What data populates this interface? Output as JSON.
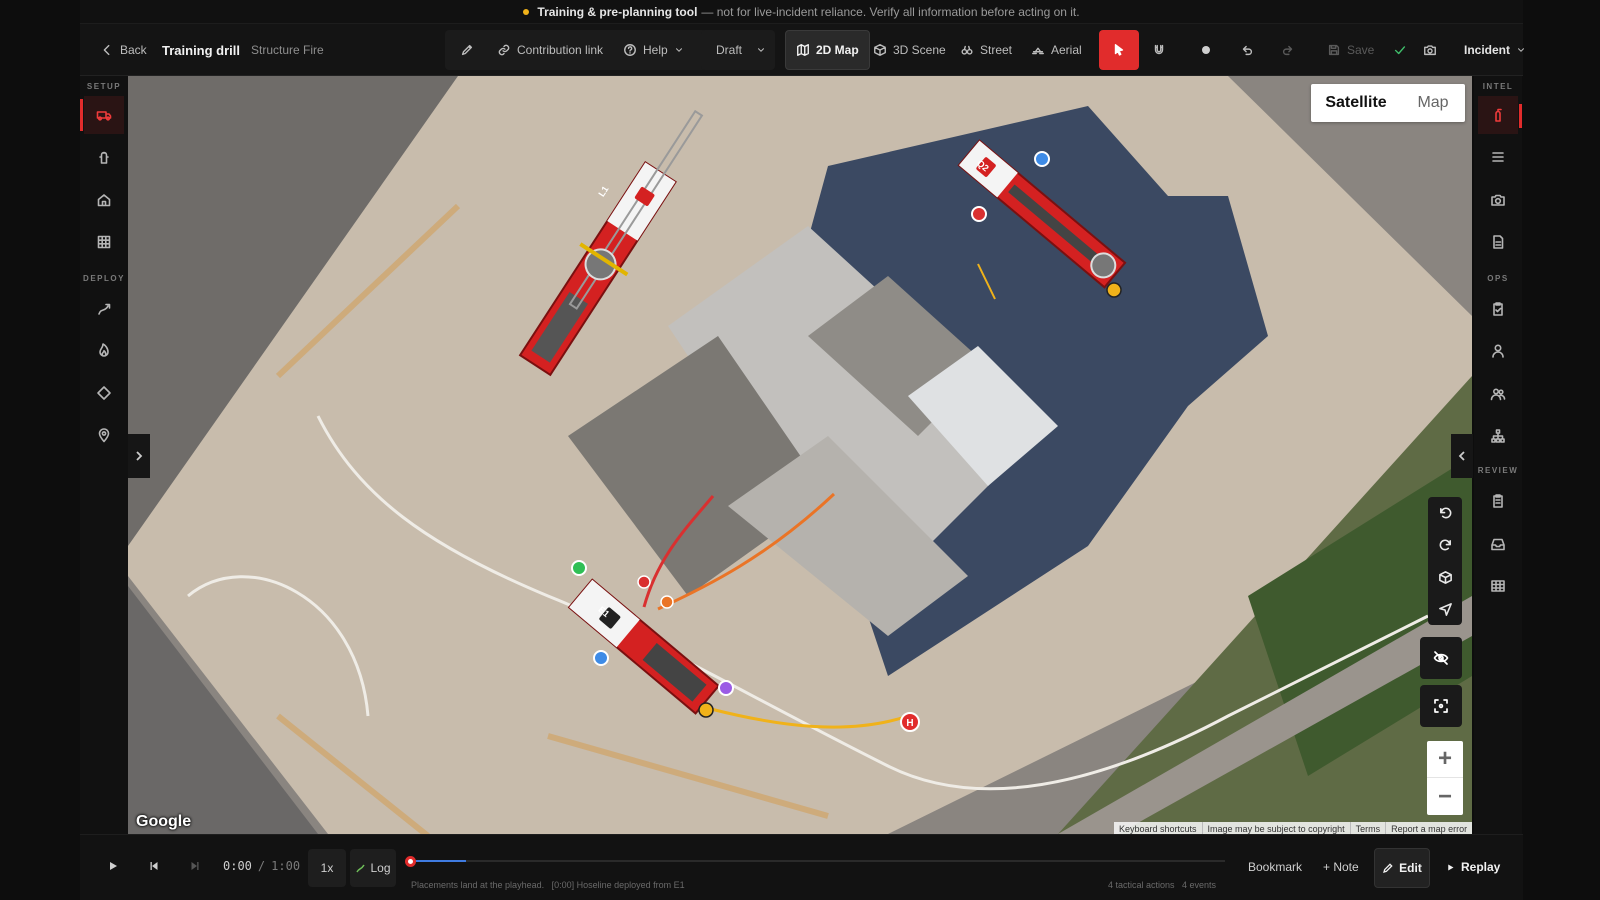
{
  "banner": {
    "strong": "Training & pre-planning tool",
    "rest": "— not for live-incident reliance. Verify all information before acting on it."
  },
  "toolbar": {
    "back": "Back",
    "title": "Training drill",
    "subtitle": "Structure Fire",
    "contribution": "Contribution link",
    "help": "Help",
    "draft": "Draft",
    "views": [
      "2D Map",
      "3D Scene",
      "Street",
      "Aerial"
    ],
    "active_view": "2D Map",
    "save": "Save",
    "incident": "Incident"
  },
  "left_sidebar": {
    "sections": [
      "SETUP",
      "DEPLOY"
    ],
    "items": [
      "apparatus-icon",
      "hydrant-icon",
      "home-icon",
      "grid-icon",
      "hose-icon",
      "fire-icon",
      "diamond-icon",
      "pin-icon"
    ]
  },
  "right_sidebar": {
    "sections": [
      "INTEL",
      "OPS",
      "REVIEW"
    ],
    "items": [
      "extinguisher-icon",
      "list-icon",
      "camera-icon",
      "document-icon",
      "clipboard-check-icon",
      "person-icon",
      "people-icon",
      "org-chart-icon",
      "report-icon",
      "inbox-icon",
      "table-icon"
    ]
  },
  "map": {
    "toggle": [
      "Satellite",
      "Map"
    ],
    "active_toggle": "Satellite",
    "google": "Google",
    "attributions": [
      "Keyboard shortcuts",
      "Image may be subject to copyright",
      "Terms",
      "Report a map error"
    ],
    "units": [
      "L1",
      "Q2",
      "E1"
    ],
    "hydrant_label": "H",
    "colors": {
      "engine_red": "#d42121",
      "supply_line": "#f0b21a",
      "attack_line_red": "#d93030",
      "attack_line_orange": "#ea7426",
      "blue": "#3e8be6",
      "green": "#2fbf55",
      "purple": "#9b5be5"
    }
  },
  "timeline": {
    "current": "0:00",
    "separator": "/",
    "duration": "1:00",
    "speed": "1x",
    "log": "Log",
    "status": "Placements land at the playhead.   [0:00] Hoseline deployed from E1",
    "counts": "4 tactical actions   4 events",
    "bookmark": "Bookmark",
    "note": "+ Note",
    "edit": "Edit",
    "replay": "Replay"
  }
}
